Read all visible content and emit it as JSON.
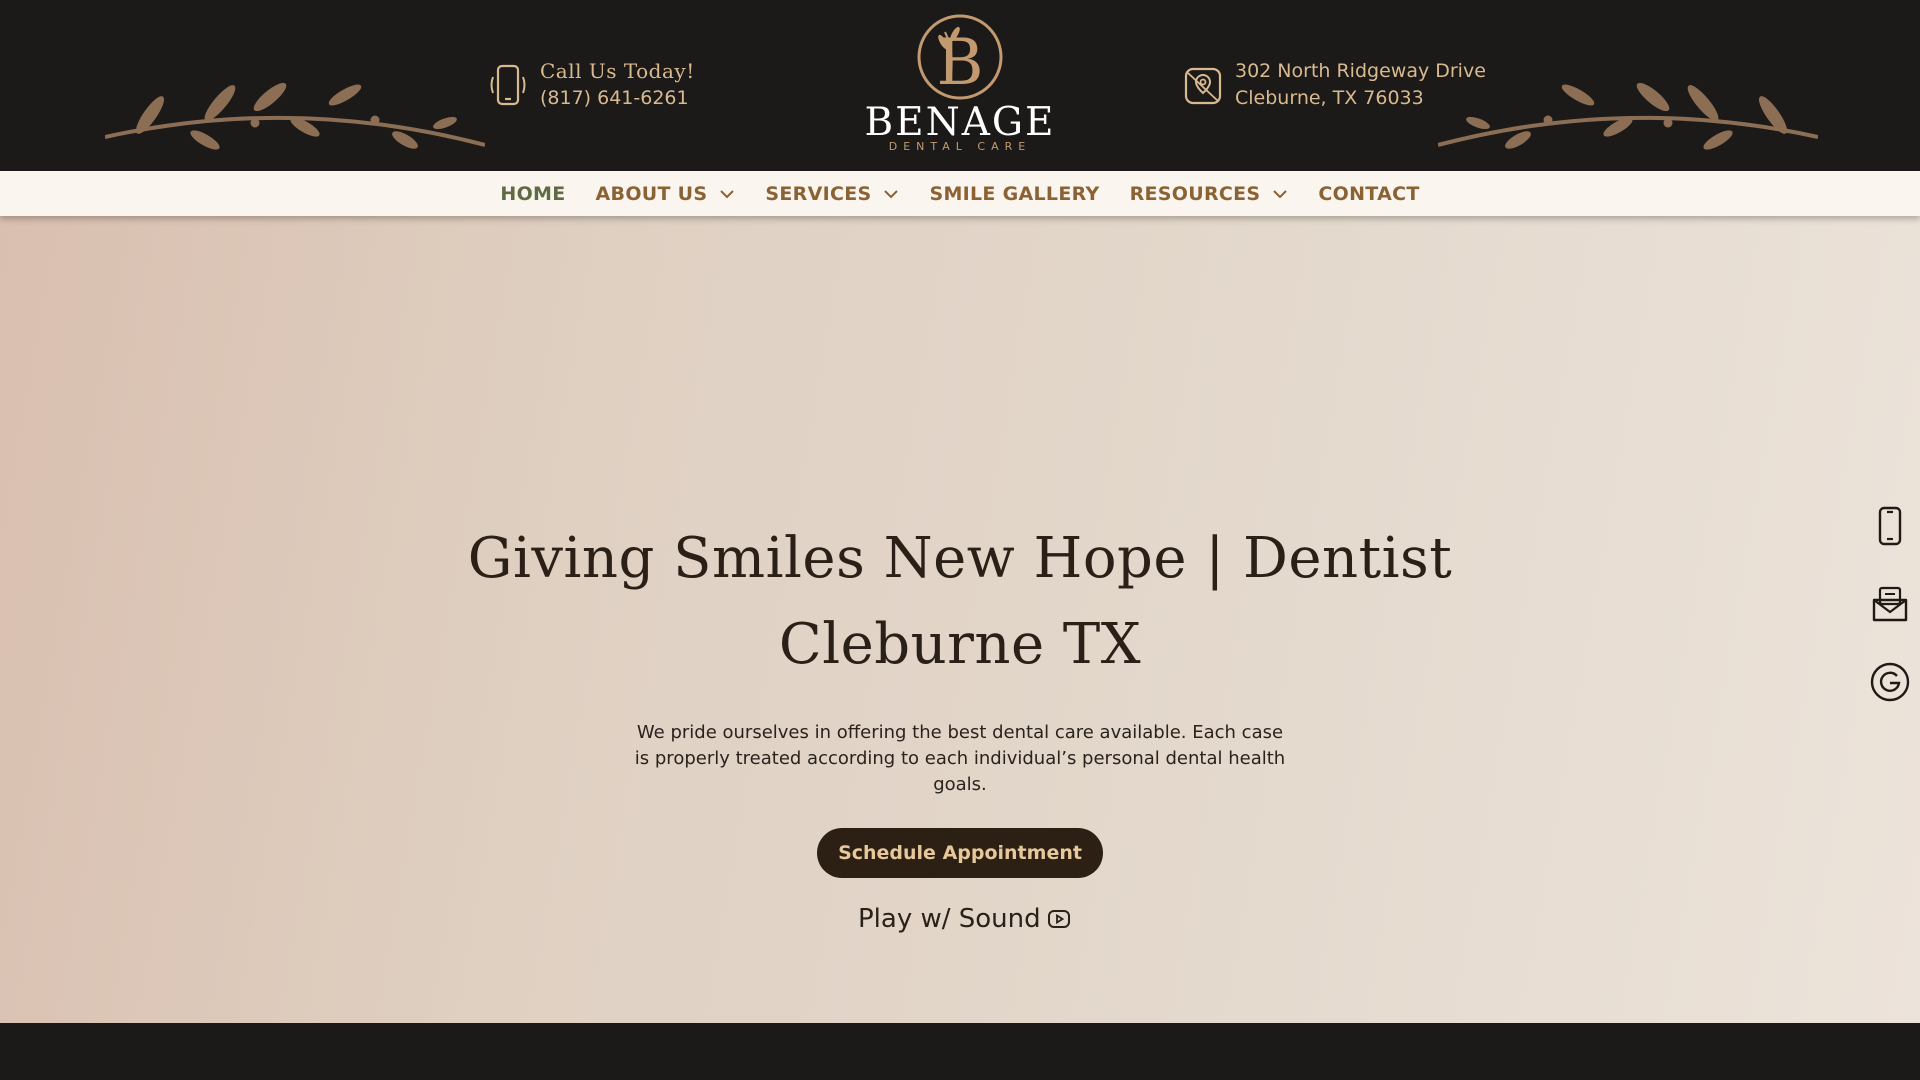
{
  "header": {
    "call_title": "Call Us Today!",
    "phone": "(817) 641-6261",
    "address_line1": "302 North Ridgeway Drive",
    "address_line2": "Cleburne, TX 76033",
    "logo_word": "BENAGE",
    "logo_sub": "DENTAL CARE",
    "icons": [
      "phone-icon",
      "map-pin-icon",
      "branch-ornament"
    ]
  },
  "nav": {
    "items": [
      {
        "label": "HOME",
        "active": true,
        "dropdown": false
      },
      {
        "label": "ABOUT US",
        "active": false,
        "dropdown": true
      },
      {
        "label": "SERVICES",
        "active": false,
        "dropdown": true
      },
      {
        "label": "SMILE GALLERY",
        "active": false,
        "dropdown": false
      },
      {
        "label": "RESOURCES",
        "active": false,
        "dropdown": true
      },
      {
        "label": "CONTACT",
        "active": false,
        "dropdown": false
      }
    ]
  },
  "hero": {
    "title_line1": "Giving Smiles New Hope | Dentist",
    "title_line2": "Cleburne TX",
    "description": "We pride ourselves in offering the best dental care available. Each case is properly treated according to each individual’s personal dental health goals.",
    "cta_label": "Schedule Appointment",
    "play_label": "Play w/ Sound"
  },
  "side_icons": [
    "phone-icon",
    "mail-icon",
    "google-icon"
  ],
  "colors": {
    "dark_bg": "#1b1a18",
    "gold": "#d9b98f",
    "nav_text": "#8b6234",
    "nav_active": "#5f6b42",
    "cta_bg": "#2c1f14",
    "cta_text": "#e7c89b"
  }
}
